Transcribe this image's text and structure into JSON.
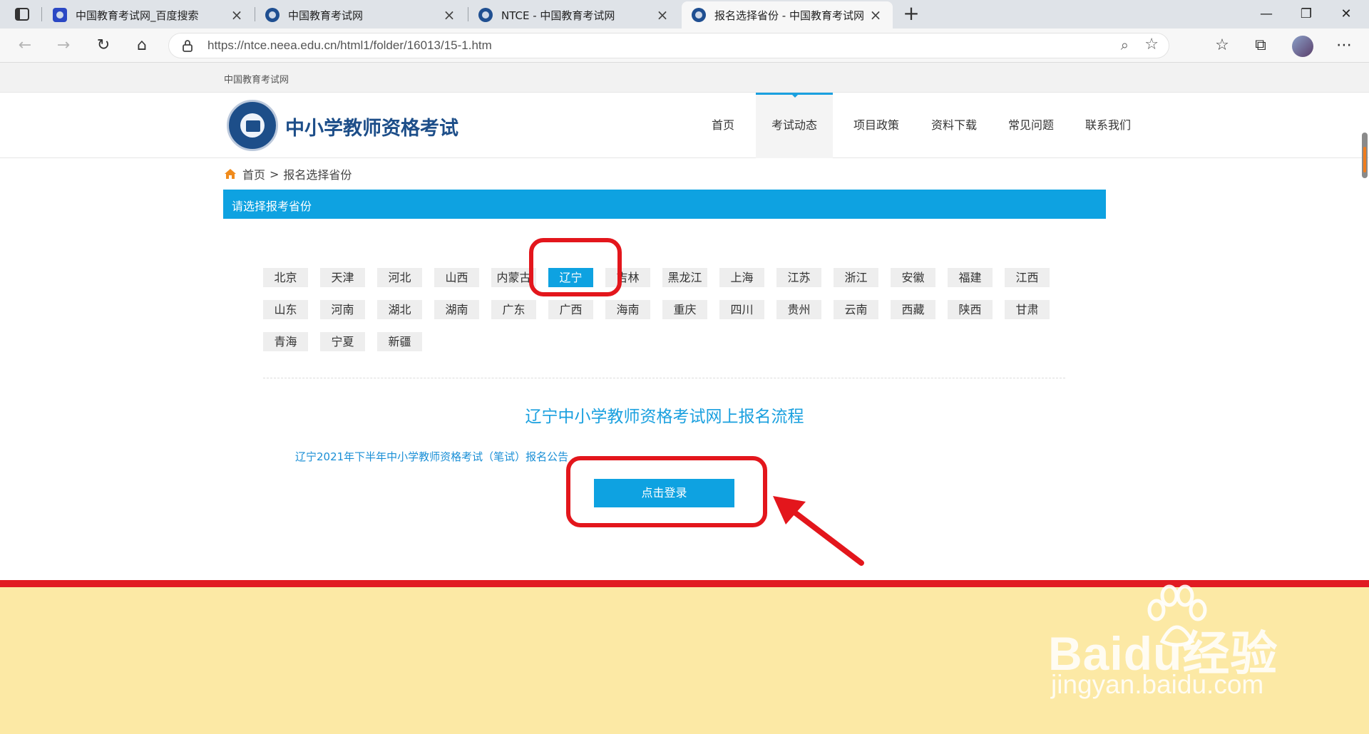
{
  "browser": {
    "tabs": [
      {
        "title": "中国教育考试网_百度搜索"
      },
      {
        "title": "中国教育考试网"
      },
      {
        "title": "NTCE - 中国教育考试网"
      },
      {
        "title": "报名选择省份 - 中国教育考试网"
      }
    ],
    "address": "https://ntce.neea.edu.cn/html1/folder/16013/15-1.htm"
  },
  "site": {
    "top_label": "中国教育考试网",
    "title": "中小学教师资格考试",
    "nav": [
      "首页",
      "考试动态",
      "项目政策",
      "资料下载",
      "常见问题",
      "联系我们"
    ],
    "active_nav": "考试动态"
  },
  "breadcrumb": {
    "home": "首页",
    "separator": ">",
    "current": "报名选择省份"
  },
  "section_title": "请选择报考省份",
  "provinces": [
    "北京",
    "天津",
    "河北",
    "山西",
    "内蒙古",
    "辽宁",
    "吉林",
    "黑龙江",
    "上海",
    "江苏",
    "浙江",
    "安徽",
    "福建",
    "江西",
    "山东",
    "河南",
    "湖北",
    "湖南",
    "广东",
    "广西",
    "海南",
    "重庆",
    "四川",
    "贵州",
    "云南",
    "西藏",
    "陕西",
    "甘肃",
    "青海",
    "宁夏",
    "新疆"
  ],
  "selected_province": "辽宁",
  "process_title": "辽宁中小学教师资格考试网上报名流程",
  "notice_link": "辽宁2021年下半年中小学教师资格考试（笔试）报名公告",
  "login_button": "点击登录",
  "watermark": {
    "brand": "Baidu经验",
    "url": "jingyan.baidu.com"
  },
  "colors": {
    "accent": "#0ea2e1",
    "annotation": "#e3161c",
    "footer": "#fce9a5"
  }
}
